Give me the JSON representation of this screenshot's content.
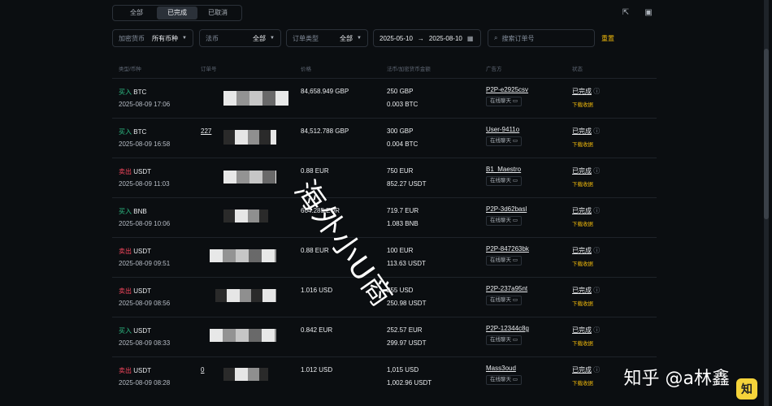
{
  "tabs": [
    {
      "label": "全部"
    },
    {
      "label": "已完成"
    },
    {
      "label": "已取消"
    }
  ],
  "filters": {
    "coin": {
      "label": "加密货币",
      "value": "所有币种"
    },
    "fiat": {
      "label": "法币",
      "value": "全部"
    },
    "type": {
      "label": "订单类型",
      "value": "全部"
    },
    "date_from": "2025-05-10",
    "date_to": "2025-08-10",
    "search_placeholder": "搜索订单号",
    "reset_label": "重置"
  },
  "columns": [
    "类型/币种",
    "订单号",
    "价格",
    "法币/加密货币金额",
    "广告方",
    "状态"
  ],
  "orders": [
    {
      "type": "买入",
      "coin": "BTC",
      "time": "2025-08-09 17:06",
      "order_no": "",
      "price": "84,658.949 GBP",
      "fiat_amount": "250 GBP",
      "crypto_amount": "0.003 BTC",
      "counterparty": "P2P-e2925csv",
      "chat": "在线聊天",
      "status": "已完成",
      "receipt": "下载收据"
    },
    {
      "type": "买入",
      "coin": "BTC",
      "time": "2025-08-09 16:58",
      "order_no": "227",
      "price": "84,512.788 GBP",
      "fiat_amount": "300 GBP",
      "crypto_amount": "0.004 BTC",
      "counterparty": "User-9411o",
      "chat": "在线聊天",
      "status": "已完成",
      "receipt": "下载收据"
    },
    {
      "type": "卖出",
      "coin": "USDT",
      "time": "2025-08-09 11:03",
      "order_no": "",
      "price": "0.88 EUR",
      "fiat_amount": "750 EUR",
      "crypto_amount": "852.27 USDT",
      "counterparty": "B1_Maestro",
      "chat": "在线聊天",
      "status": "已完成",
      "receipt": "下载收据"
    },
    {
      "type": "买入",
      "coin": "BNB",
      "time": "2025-08-09 10:06",
      "order_no": "",
      "price": "664.285 EUR",
      "fiat_amount": "719.7 EUR",
      "crypto_amount": "1.083 BNB",
      "counterparty": "P2P-3d62basl",
      "chat": "在线聊天",
      "status": "已完成",
      "receipt": "下载收据"
    },
    {
      "type": "卖出",
      "coin": "USDT",
      "time": "2025-08-09 09:51",
      "order_no": "",
      "price": "0.88 EUR",
      "fiat_amount": "100 EUR",
      "crypto_amount": "113.63 USDT",
      "counterparty": "P2P-847263bk",
      "chat": "在线聊天",
      "status": "已完成",
      "receipt": "下载收据"
    },
    {
      "type": "卖出",
      "coin": "USDT",
      "time": "2025-08-09 08:56",
      "order_no": "",
      "price": "1.016 USD",
      "fiat_amount": "255 USD",
      "crypto_amount": "250.98 USDT",
      "counterparty": "P2P-237a95nt",
      "chat": "在线聊天",
      "status": "已完成",
      "receipt": "下载收据"
    },
    {
      "type": "买入",
      "coin": "USDT",
      "time": "2025-08-09 08:33",
      "order_no": "",
      "price": "0.842 EUR",
      "fiat_amount": "252.57 EUR",
      "crypto_amount": "299.97 USDT",
      "counterparty": "P2P-12344c8g",
      "chat": "在线聊天",
      "status": "已完成",
      "receipt": "下载收据"
    },
    {
      "type": "卖出",
      "coin": "USDT",
      "time": "2025-08-09 08:28",
      "order_no": "0",
      "price": "1.012 USD",
      "fiat_amount": "1,015 USD",
      "crypto_amount": "1,002.96 USDT",
      "counterparty": "Mass3oud",
      "chat": "在线聊天",
      "status": "已完成",
      "receipt": "下载收据"
    }
  ],
  "watermark": "海外小U商",
  "brand": "知乎 @a林鑫",
  "colors": {
    "buy": "#2ebd85",
    "sell": "#f6465d",
    "accent": "#f0b90b",
    "bg": "#0b0e11"
  }
}
